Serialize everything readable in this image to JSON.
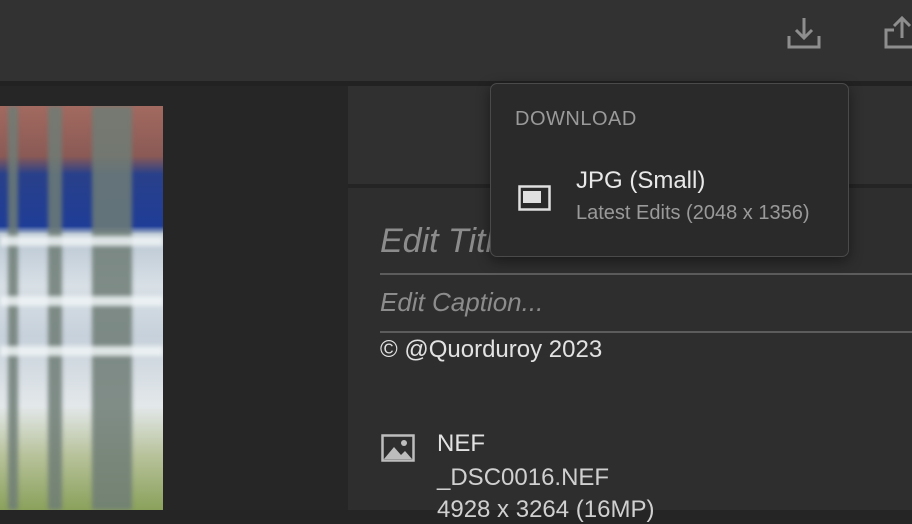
{
  "toolbar": {
    "download_icon": "download-icon",
    "share_icon": "share-icon"
  },
  "download_menu": {
    "heading": "DOWNLOAD",
    "option": {
      "icon": "image-frame-icon",
      "title": "JPG (Small)",
      "subtitle": "Latest Edits (2048 x 1356)"
    }
  },
  "info_panel": {
    "title_placeholder": "Edit Title...",
    "caption_placeholder": "Edit Caption...",
    "copyright": "© @Quorduroy 2023",
    "file": {
      "icon": "image-icon",
      "type": "NEF",
      "name": "_DSC0016.NEF",
      "dimensions": "4928 x 3264 (16MP)"
    }
  },
  "colors": {
    "background": "#252525",
    "toolbar": "#323232",
    "panel": "#2e2e2e",
    "popover": "#2a2a2a"
  }
}
